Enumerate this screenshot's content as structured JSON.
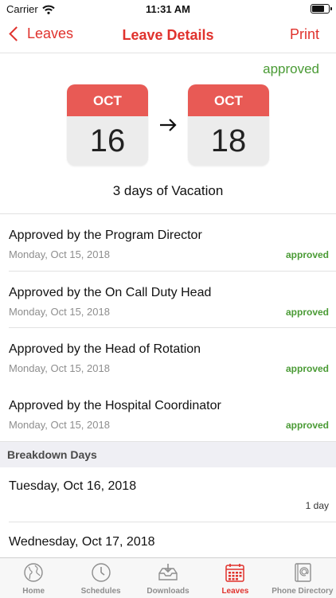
{
  "status_bar": {
    "carrier": "Carrier",
    "time": "11:31 AM",
    "battery_level": 0.85
  },
  "nav": {
    "back_label": "Leaves",
    "title": "Leave Details",
    "print_label": "Print"
  },
  "leave": {
    "status": "approved",
    "start": {
      "month": "OCT",
      "day": "16"
    },
    "end": {
      "month": "OCT",
      "day": "18"
    },
    "summary": "3 days of Vacation"
  },
  "approvals": [
    {
      "title": "Approved by the Program Director",
      "date": "Monday, Oct 15, 2018",
      "status": "approved"
    },
    {
      "title": "Approved by the On Call Duty Head",
      "date": "Monday, Oct 15, 2018",
      "status": "approved"
    },
    {
      "title": "Approved by the Head of Rotation",
      "date": "Monday, Oct 15, 2018",
      "status": "approved"
    },
    {
      "title": "Approved by the Hospital Coordinator",
      "date": "Monday, Oct 15, 2018",
      "status": "approved"
    }
  ],
  "breakdown": {
    "header": "Breakdown Days",
    "days": [
      {
        "date": "Tuesday, Oct 16, 2018",
        "count": "1 day"
      },
      {
        "date": "Wednesday, Oct 17, 2018",
        "count": ""
      }
    ]
  },
  "tabs": [
    {
      "label": "Home",
      "icon": "globe-icon"
    },
    {
      "label": "Schedules",
      "icon": "clock-icon"
    },
    {
      "label": "Downloads",
      "icon": "inbox-download-icon"
    },
    {
      "label": "Leaves",
      "icon": "calendar-icon",
      "active": true
    },
    {
      "label": "Phone Directory",
      "icon": "contacts-book-icon"
    }
  ],
  "colors": {
    "accent": "#e0322d",
    "approved": "#4a9b35",
    "calendar_header": "#e85a55"
  }
}
